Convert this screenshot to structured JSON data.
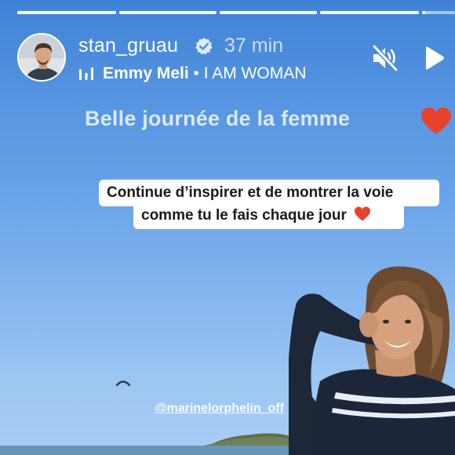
{
  "story": {
    "progress_segments": [
      1,
      1,
      1,
      1,
      0.1
    ],
    "username": "stan_gruau",
    "verified_icon": "verified-badge-icon",
    "time": "37 min",
    "music": {
      "icon": "music-bars-icon",
      "artist": "Emmy Meli",
      "separator": " • ",
      "song": "I AM WOMAN"
    },
    "controls": {
      "mute_icon": "speaker-muted-icon",
      "play_icon": "play-icon"
    },
    "headline": "Belle journée de la femme",
    "headline_emoji": "heart-icon",
    "captions": {
      "line1": "Continue d’inspirer et de montrer la voie",
      "line2": "comme tu le fais chaque jour"
    },
    "mention": "@marinelorphelin_off",
    "colors": {
      "heart": "#e8432c",
      "sky_top": "#3f82d6",
      "sky_bottom": "#a8cdf4"
    }
  }
}
